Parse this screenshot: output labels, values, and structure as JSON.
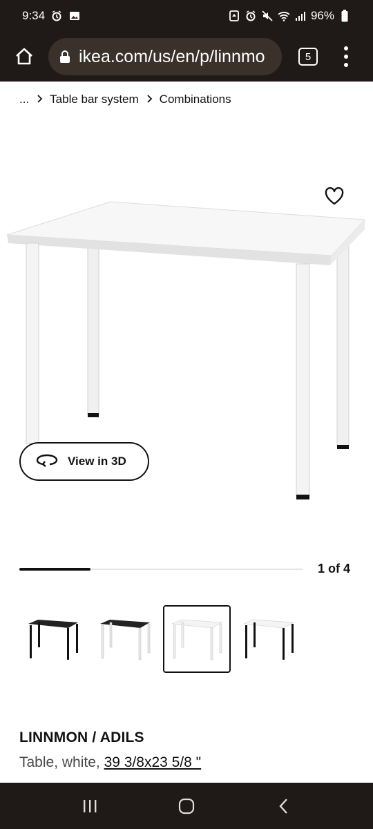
{
  "status_bar": {
    "time": "9:34",
    "battery": "96%"
  },
  "url_bar": {
    "url": "ikea.com/us/en/p/linnmo",
    "tab_count": "5"
  },
  "breadcrumb": {
    "ellipsis": "...",
    "items": [
      "Table bar system",
      "Combinations"
    ]
  },
  "gallery": {
    "view_3d_label": "View in 3D",
    "counter": "1 of 4",
    "progress": 0.25,
    "selected_thumb": 2
  },
  "product": {
    "name": "LINNMON / ADILS",
    "desc_prefix": "Table, white,",
    "dimensions": "39 3/8x23 5/8 \""
  }
}
